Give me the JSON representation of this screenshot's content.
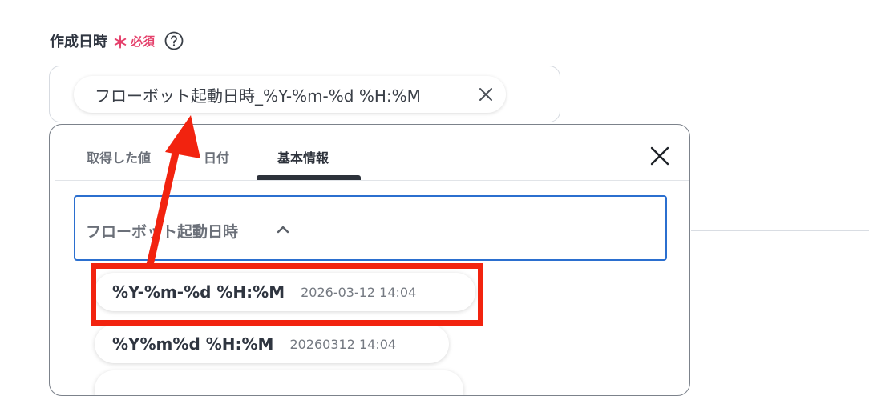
{
  "field": {
    "label": "作成日時",
    "asterisk": "＊",
    "required": "必須",
    "help_icon": "question-circle-icon"
  },
  "chip": {
    "text": "フローボット起動日時_%Y-%m-%d %H:%M",
    "close_icon": "close-icon"
  },
  "tabs": [
    {
      "label": "取得した値"
    },
    {
      "label": "日付"
    },
    {
      "label": "基本情報",
      "active": true
    }
  ],
  "popover_close_icon": "close-icon",
  "section": {
    "label": "フローボット起動日時",
    "chevron_icon": "chevron-up-icon"
  },
  "options": [
    {
      "format": "%Y-%m-%d %H:%M",
      "example": "2026-03-12 14:04"
    },
    {
      "format": "%Y%m%d %H:%M",
      "example": "20260312 14:04"
    },
    {
      "format": "",
      "example": ""
    }
  ],
  "colors": {
    "accent_red": "#f2230f",
    "required_pink": "#e5406b",
    "focus_blue": "#2b6fcf",
    "text_dark": "#2f3540"
  }
}
